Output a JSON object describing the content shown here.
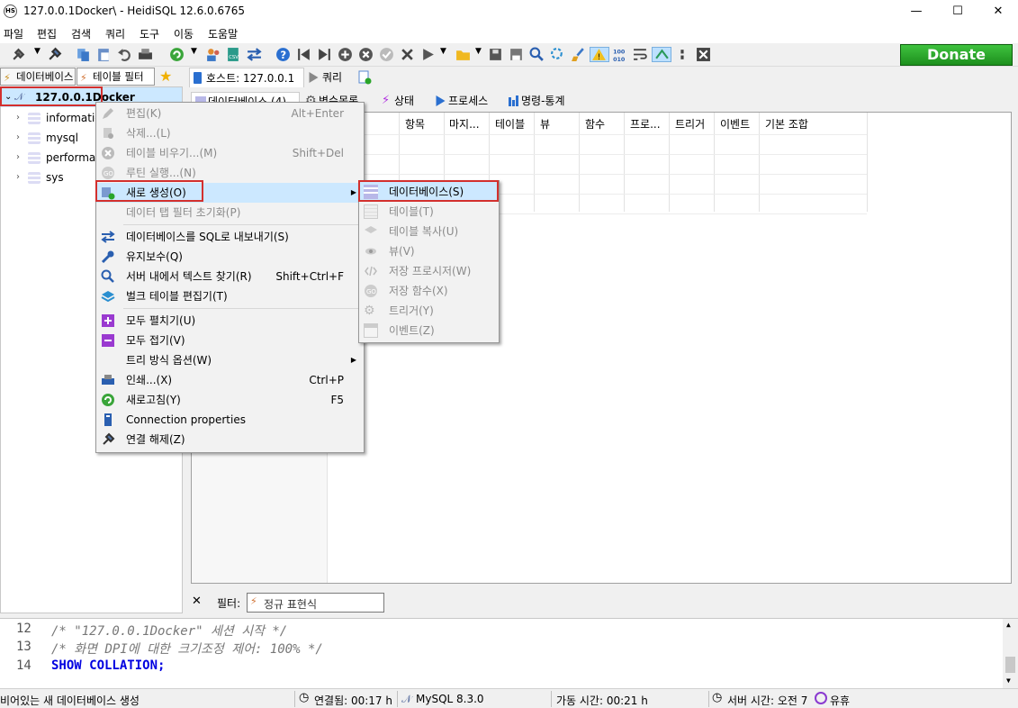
{
  "window": {
    "title": "127.0.0.1Docker\\ - HeidiSQL 12.6.0.6765",
    "app_icon": "HS",
    "minimize": "—",
    "maximize": "☐",
    "close": "✕"
  },
  "menu": [
    "파일",
    "편집",
    "검색",
    "쿼리",
    "도구",
    "이동",
    "도움말"
  ],
  "donate_label": "Donate",
  "left_tabs": {
    "databases": "데이터베이스",
    "table_filter": "테이블 필터"
  },
  "tree": {
    "root": "127.0.0.1Docker",
    "items": [
      "information_schema",
      "mysql",
      "performance_schema",
      "sys"
    ]
  },
  "right_tabs": {
    "host": "호스트: 127.0.0.1",
    "query": "쿼리"
  },
  "sub_tabs": [
    "데이터베이스 (4)",
    "변수목록",
    "상태",
    "프로세스",
    "명령-통계"
  ],
  "grid_columns": [
    "항목",
    "마지...",
    "테이블",
    "뷰",
    "함수",
    "프로...",
    "트리거",
    "이벤트",
    "기본 조합"
  ],
  "filter": {
    "label": "필터:",
    "value": "정규 표현식"
  },
  "sql_log": [
    {
      "line": "12",
      "text": "/* \"127.0.0.1Docker\" 세션 시작 */",
      "kind": "comment"
    },
    {
      "line": "13",
      "text": "/* 화면 DPI에 대한 크기조정 제어: 100% */",
      "kind": "comment"
    },
    {
      "line": "14",
      "text": "SHOW COLLATION;",
      "kind": "keyword"
    }
  ],
  "status": {
    "message": "비어있는 새 데이터베이스 생성",
    "connected": "연결됨: 00:17 h",
    "server": "MySQL 8.3.0",
    "uptime": "가동 시간: 00:21 h",
    "server_time": "서버 시간: 오전 7",
    "idle": "유휴"
  },
  "context_menu": [
    {
      "label": "편집(K)",
      "shortcut": "Alt+Enter",
      "disabled": true,
      "icon": "pencil-icon"
    },
    {
      "label": "삭제...(L)",
      "shortcut": "",
      "disabled": true,
      "icon": "delete-icon"
    },
    {
      "label": "테이블 비우기...(M)",
      "shortcut": "Shift+Del",
      "disabled": true,
      "icon": "clear-icon"
    },
    {
      "label": "루틴 실행...(N)",
      "shortcut": "",
      "disabled": true,
      "icon": "run-routine-icon"
    },
    {
      "label": "새로 생성(O)",
      "shortcut": "",
      "disabled": false,
      "icon": "create-new-icon",
      "submenu": true
    },
    {
      "label": "데이터 탭 필터 초기화(P)",
      "shortcut": "",
      "disabled": true,
      "icon": ""
    },
    {
      "label": "데이터베이스를 SQL로 내보내기(S)",
      "shortcut": "",
      "disabled": false,
      "icon": "export-icon"
    },
    {
      "label": "유지보수(Q)",
      "shortcut": "",
      "disabled": false,
      "icon": "wrench-icon"
    },
    {
      "label": "서버 내에서 텍스트 찾기(R)",
      "shortcut": "Shift+Ctrl+F",
      "disabled": false,
      "icon": "search-icon"
    },
    {
      "label": "벌크 테이블 편집기(T)",
      "shortcut": "",
      "disabled": false,
      "icon": "bulk-edit-icon"
    },
    {
      "label": "모두 펼치기(U)",
      "shortcut": "",
      "disabled": false,
      "icon": "expand-icon"
    },
    {
      "label": "모두 접기(V)",
      "shortcut": "",
      "disabled": false,
      "icon": "collapse-icon"
    },
    {
      "label": "트리 방식 옵션(W)",
      "shortcut": "",
      "disabled": false,
      "icon": "",
      "submenu": true
    },
    {
      "label": "인쇄...(X)",
      "shortcut": "Ctrl+P",
      "disabled": false,
      "icon": "printer-icon"
    },
    {
      "label": "새로고침(Y)",
      "shortcut": "F5",
      "disabled": false,
      "icon": "refresh-icon"
    },
    {
      "label": "Connection properties",
      "shortcut": "",
      "disabled": false,
      "icon": "connection-icon"
    },
    {
      "label": "연결 해제(Z)",
      "shortcut": "",
      "disabled": false,
      "icon": "disconnect-icon"
    }
  ],
  "submenu": [
    {
      "label": "데이터베이스(S)",
      "disabled": false,
      "icon": "database-icon"
    },
    {
      "label": "테이블(T)",
      "disabled": true,
      "icon": "table-icon"
    },
    {
      "label": "테이블 복사(U)",
      "disabled": true,
      "icon": "copy-table-icon"
    },
    {
      "label": "뷰(V)",
      "disabled": true,
      "icon": "view-icon"
    },
    {
      "label": "저장 프로시저(W)",
      "disabled": true,
      "icon": "procedure-icon"
    },
    {
      "label": "저장 함수(X)",
      "disabled": true,
      "icon": "function-icon"
    },
    {
      "label": "트리거(Y)",
      "disabled": true,
      "icon": "trigger-icon"
    },
    {
      "label": "이벤트(Z)",
      "disabled": true,
      "icon": "event-icon"
    }
  ],
  "colors": {
    "highlight": "#cce8ff",
    "annotation_red": "#d3302e",
    "donate_green": "#2aa52a",
    "sql_keyword": "#0000e0"
  }
}
